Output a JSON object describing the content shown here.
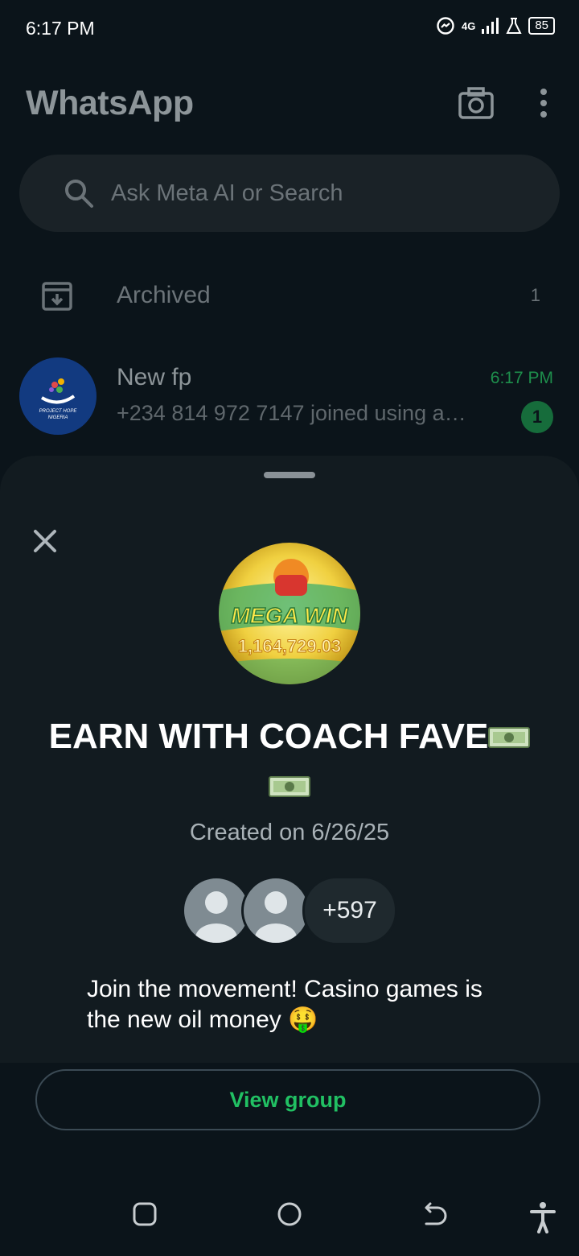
{
  "status_bar": {
    "time": "6:17 PM",
    "network": "4G",
    "battery": "85"
  },
  "header": {
    "title": "WhatsApp",
    "icons": [
      "camera-icon",
      "more-options-icon"
    ]
  },
  "search": {
    "placeholder": "Ask Meta AI or Search"
  },
  "archived": {
    "label": "Archived",
    "count": "1"
  },
  "chat": {
    "name": "New fp",
    "time": "6:17 PM",
    "preview": "+234 814 972 7147 joined using a…",
    "unread": "1",
    "avatar_text": "PROJECT HOPE NIGERIA"
  },
  "sheet": {
    "group_photo_text": "MEGA WIN",
    "group_photo_amount": "1,164,729.03",
    "title": "EARN WITH COACH FAVE",
    "created": "Created on 6/26/25",
    "member_extra": "+597",
    "description": "Join the movement! Casino games is the new oil money 🤑",
    "button": "View group"
  },
  "colors": {
    "background": "#0b141a",
    "sheet": "#121b20",
    "accent_green": "#21c063"
  }
}
